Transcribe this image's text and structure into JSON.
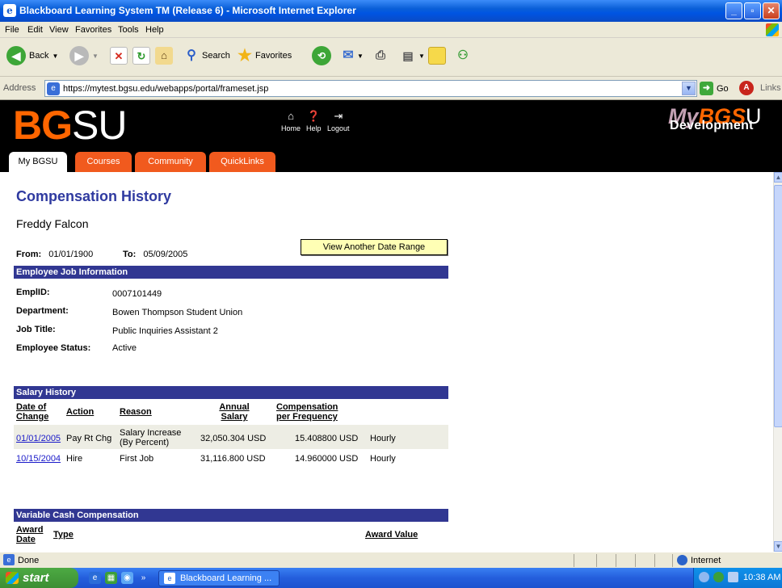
{
  "window": {
    "title": "Blackboard Learning System TM (Release 6) - Microsoft Internet Explorer"
  },
  "menu": [
    "File",
    "Edit",
    "View",
    "Favorites",
    "Tools",
    "Help"
  ],
  "toolbar": {
    "back_label": "Back",
    "search_label": "Search",
    "favorites_label": "Favorites"
  },
  "address": {
    "label": "Address",
    "url": "https://mytest.bgsu.edu/webapps/portal/frameset.jsp",
    "go_label": "Go",
    "links_label": "Links"
  },
  "portal": {
    "logo_bg": "BG",
    "logo_su": "SU",
    "header_links": [
      "Home",
      "Help",
      "Logout"
    ],
    "brand_my": "My",
    "brand_bgs": "BGS",
    "brand_u": "U",
    "brand_dev": "Development",
    "tabs": [
      "My BGSU",
      "Courses",
      "Community",
      "QuickLinks"
    ],
    "accent_color": "#FF6600",
    "section_color": "#313792"
  },
  "page": {
    "title": "Compensation History",
    "person": "Freddy Falcon",
    "from_label": "From:",
    "from_value": "01/01/1900",
    "to_label": "To:",
    "to_value": "05/09/2005",
    "range_button": "View Another Date Range"
  },
  "employee": {
    "section_title": "Employee Job Information",
    "rows": [
      {
        "label": "EmplID:",
        "value": "0007101449"
      },
      {
        "label": "Department:",
        "value": "Bowen Thompson Student Union"
      },
      {
        "label": "Job Title:",
        "value": "Public Inquiries Assistant 2"
      },
      {
        "label": "Employee Status:",
        "value": "Active"
      }
    ]
  },
  "salary": {
    "section_title": "Salary History",
    "headers": {
      "date_1": "Date of",
      "date_2": "Change",
      "action": "Action",
      "reason": "Reason",
      "annual_1": "Annual",
      "annual_2": "Salary",
      "comp_1": "Compensation",
      "comp_2": "per Frequency"
    },
    "rows": [
      {
        "date": "01/01/2005",
        "action": "Pay Rt Chg",
        "reason_1": "Salary Increase",
        "reason_2": "(By Percent)",
        "annual": "32,050.304 USD",
        "comp": "15.408800 USD",
        "freq": "Hourly"
      },
      {
        "date": "10/15/2004",
        "action": "Hire",
        "reason_1": "First Job",
        "reason_2": "",
        "annual": "31,116.800 USD",
        "comp": "14.960000 USD",
        "freq": "Hourly"
      }
    ]
  },
  "variable": {
    "section_title": "Variable Cash Compensation",
    "award_1": "Award",
    "award_2": "Date",
    "type": "Type",
    "value": "Award Value"
  },
  "statusbar": {
    "text": "Done",
    "zone": "Internet"
  },
  "taskbar": {
    "start": "start",
    "task": "Blackboard Learning ...",
    "clock": "10:38 AM"
  }
}
